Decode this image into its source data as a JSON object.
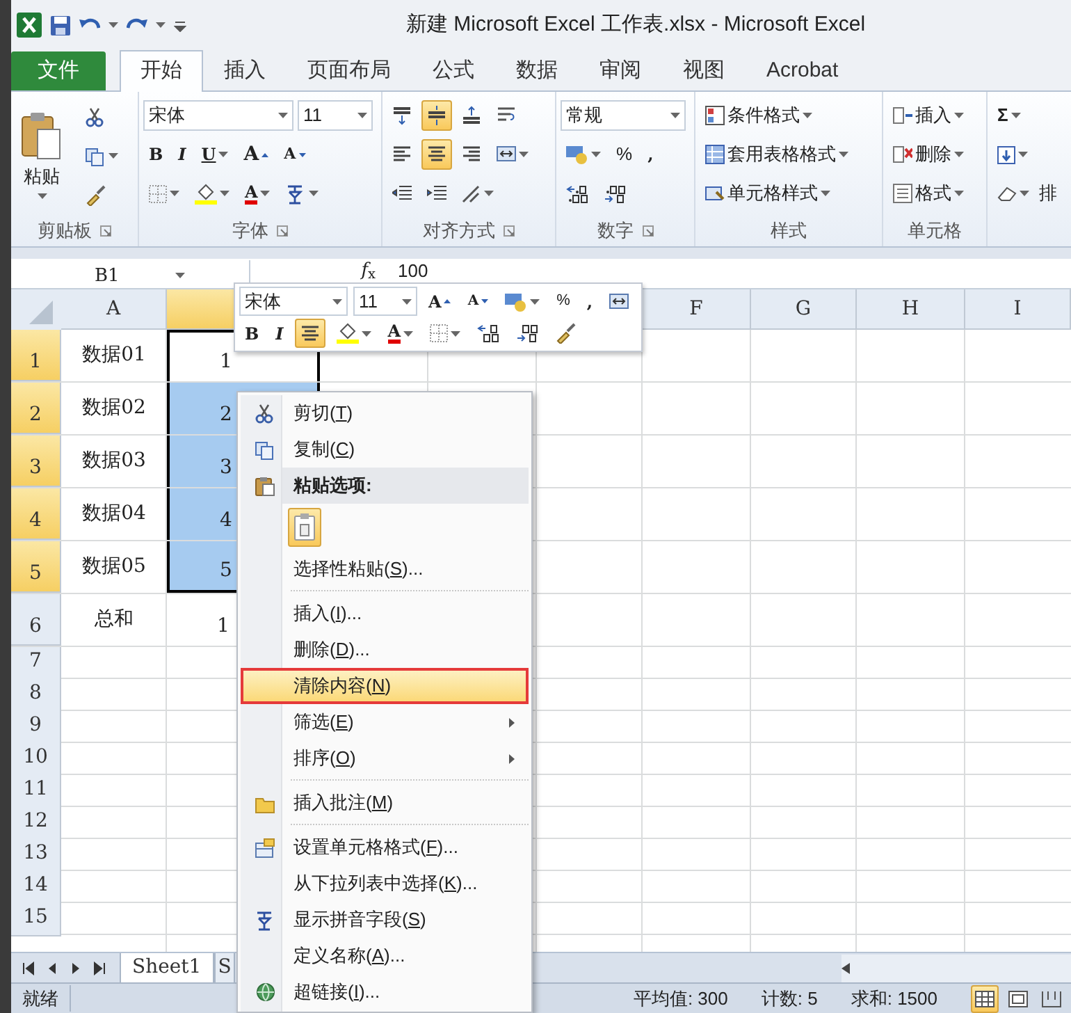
{
  "title_bar": {
    "title": "新建 Microsoft Excel 工作表.xlsx - Microsoft Excel"
  },
  "ribbon_tabs": [
    {
      "label": "文件",
      "kind": "file",
      "selected": false
    },
    {
      "label": "开始",
      "kind": "tab",
      "selected": true
    },
    {
      "label": "插入",
      "kind": "tab",
      "selected": false
    },
    {
      "label": "页面布局",
      "kind": "tab",
      "selected": false
    },
    {
      "label": "公式",
      "kind": "tab",
      "selected": false
    },
    {
      "label": "数据",
      "kind": "tab",
      "selected": false
    },
    {
      "label": "审阅",
      "kind": "tab",
      "selected": false
    },
    {
      "label": "视图",
      "kind": "tab",
      "selected": false
    },
    {
      "label": "Acrobat",
      "kind": "tab",
      "selected": false
    }
  ],
  "ribbon": {
    "clipboard": {
      "paste": "粘贴",
      "group_label": "剪贴板"
    },
    "font": {
      "font_name": "宋体",
      "font_size": "11",
      "bold": "B",
      "italic": "I",
      "underline": "U",
      "grow_font": "A",
      "shrink_font": "A",
      "font_color": "A",
      "group_label": "字体"
    },
    "alignment": {
      "buttons": [
        {
          "kind": "top",
          "on": false
        },
        {
          "kind": "middle",
          "on": true
        },
        {
          "kind": "bottom",
          "on": false
        },
        {
          "kind": "wrap",
          "on": false
        },
        {
          "kind": "left",
          "on": false
        },
        {
          "kind": "center",
          "on": true
        },
        {
          "kind": "right",
          "on": false
        },
        {
          "kind": "merge",
          "on": false
        }
      ],
      "group_label": "对齐方式"
    },
    "number": {
      "format": "常规",
      "percent": "%",
      "comma": ",",
      "group_label": "数字"
    },
    "styles": {
      "items": [
        {
          "label": "条件格式",
          "kind": "conditional"
        },
        {
          "label": "套用表格格式",
          "kind": "table"
        },
        {
          "label": "单元格样式",
          "kind": "cellstyle"
        }
      ],
      "group_label": "样式"
    },
    "cells": {
      "items": [
        {
          "label": "插入",
          "kind": "insert"
        },
        {
          "label": "删除",
          "kind": "delete"
        },
        {
          "label": "格式",
          "kind": "format"
        }
      ],
      "group_label": "单元格"
    },
    "editing": {
      "autosum": "Σ",
      "sort": "排"
    }
  },
  "formula_bar": {
    "name_box": "B1",
    "function_label": "*f*$_{x}$",
    "value": "100"
  },
  "columns": [
    {
      "label": "A",
      "selected": false
    },
    {
      "selected": true
    },
    null,
    null,
    null,
    {
      "label": "F",
      "selected": false
    },
    {
      "label": "G",
      "selected": false
    },
    {
      "label": "H",
      "selected": false
    },
    {
      "label": "I",
      "selected": false
    }
  ],
  "rows": [
    {
      "header": "1",
      "selected": true,
      "cells": [
        {
          "text": "数据01",
          "selected": false
        },
        {
          "text": "1",
          "selected": true,
          "active": true
        }
      ]
    },
    {
      "header": "2",
      "selected": true,
      "cells": [
        {
          "text": "数据02",
          "selected": false
        },
        {
          "text": "2",
          "selected": true,
          "active": false
        }
      ]
    },
    {
      "header": "3",
      "selected": true,
      "cells": [
        {
          "text": "数据03",
          "selected": false
        },
        {
          "text": "3",
          "selected": true,
          "active": false
        }
      ]
    },
    {
      "header": "4",
      "selected": true,
      "cells": [
        {
          "text": "数据04",
          "selected": false
        },
        {
          "text": "4",
          "selected": true,
          "active": false
        }
      ]
    },
    {
      "header": "5",
      "selected": true,
      "cells": [
        {
          "text": "数据05",
          "selected": false
        },
        {
          "text": "5",
          "selected": true,
          "active": false
        }
      ]
    },
    {
      "header": "6",
      "selected": false,
      "cells": [
        {
          "text": "总和",
          "selected": false
        },
        {
          "text": "1",
          "selected": false
        }
      ]
    },
    {
      "header": "7",
      "selected": false,
      "cells": []
    },
    {
      "header": "8",
      "selected": false,
      "cells": []
    },
    {
      "header": "9",
      "selected": false,
      "cells": []
    },
    {
      "header": "10",
      "selected": false,
      "cells": []
    },
    {
      "header": "11",
      "selected": false,
      "cells": []
    },
    {
      "header": "12",
      "selected": false,
      "cells": []
    },
    {
      "header": "13",
      "selected": false,
      "cells": []
    },
    {
      "header": "14",
      "selected": false,
      "cells": []
    },
    {
      "header": "15",
      "selected": false,
      "cells": []
    }
  ],
  "mini_toolbar": {
    "font_name": "宋体",
    "font_size": "11",
    "grow_font": "A",
    "shrink_font": "A",
    "percent": "%",
    "comma": ",",
    "bold": "B",
    "italic": "I",
    "center_on": true,
    "font_color": "A"
  },
  "context_menu": {
    "items": [
      {
        "kind": "item",
        "label": "剪切(T)",
        "selected": false
      },
      {
        "kind": "item",
        "label": "复制(C)",
        "selected": false
      },
      {
        "kind": "header",
        "label": "粘贴选项:"
      },
      {
        "kind": "paste_options"
      },
      {
        "kind": "item",
        "label": "选择性粘贴(S)...",
        "selected": false
      },
      {
        "kind": "separator"
      },
      {
        "kind": "item",
        "label": "插入(I)...",
        "selected": false
      },
      {
        "kind": "item",
        "label": "删除(D)...",
        "selected": false
      },
      {
        "kind": "item",
        "label": "清除内容(N)",
        "selected": true
      },
      {
        "kind": "submenu",
        "label": "筛选(E)",
        "selected": false
      },
      {
        "kind": "submenu",
        "label": "排序(O)",
        "selected": false
      },
      {
        "kind": "separator"
      },
      {
        "kind": "item",
        "label": "插入批注(M)",
        "selected": false
      },
      {
        "kind": "separator"
      },
      {
        "kind": "item",
        "label": "设置单元格格式(F)...",
        "selected": false
      },
      {
        "kind": "item",
        "label": "从下拉列表中选择(K)...",
        "selected": false
      },
      {
        "kind": "item",
        "label": "显示拼音字段(S)",
        "selected": false
      },
      {
        "kind": "item",
        "label": "定义名称(A)...",
        "selected": false
      },
      {
        "kind": "item",
        "label": "超链接(I)...",
        "selected": false
      }
    ]
  },
  "sheet_tabs": [
    {
      "label": "Sheet1",
      "selected": true
    },
    {
      "label": "S",
      "selected": false
    }
  ],
  "status_bar": {
    "ready": "就绪",
    "average": "平均值: 300",
    "count": "计数: 5",
    "sum": "求和: 1500",
    "views": [
      {
        "kind": "normal",
        "selected": true
      },
      {
        "kind": "layout",
        "selected": false
      },
      {
        "kind": "pagebreak",
        "selected": false
      }
    ]
  }
}
